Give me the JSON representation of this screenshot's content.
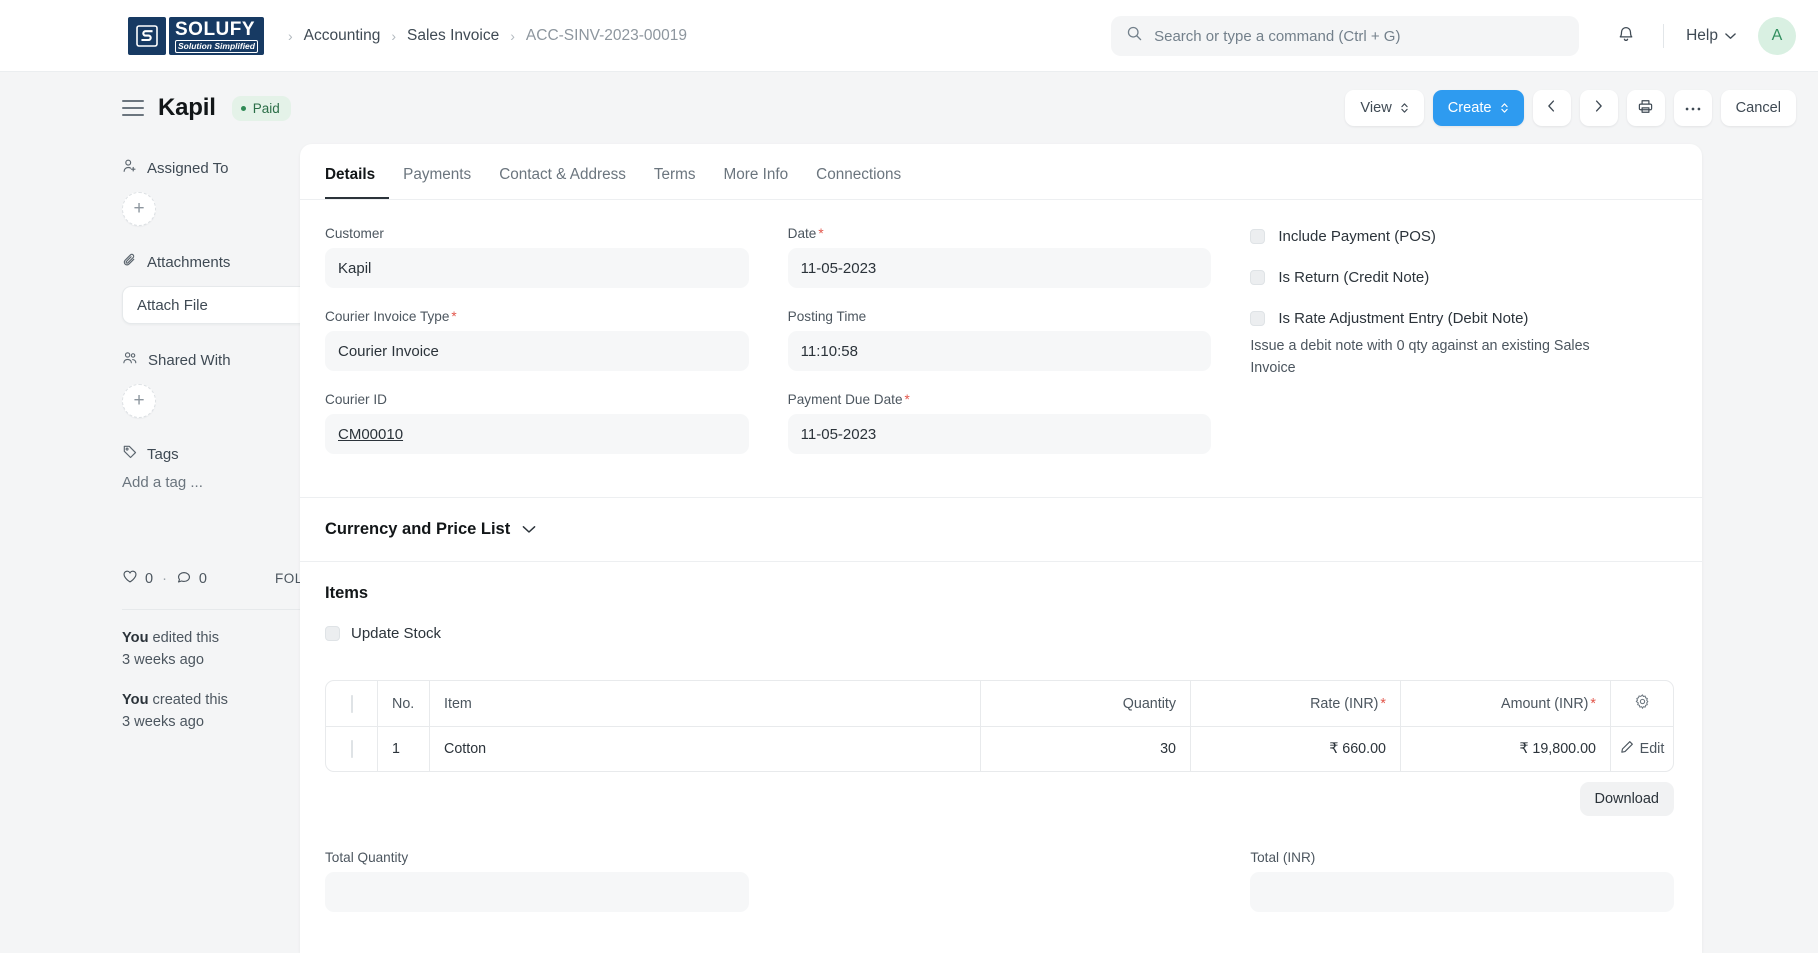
{
  "navbar": {
    "logo": {
      "word": "SOLUFY",
      "tagline": "Solution Simplified",
      "mark_letter": "S"
    },
    "breadcrumb": [
      {
        "label": "Accounting",
        "muted": false
      },
      {
        "label": "Sales Invoice",
        "muted": false
      },
      {
        "label": "ACC-SINV-2023-00019",
        "muted": true
      }
    ],
    "search": {
      "placeholder": "Search or type a command (Ctrl + G)",
      "value": ""
    },
    "help_label": "Help",
    "avatar_initial": "A",
    "icons": {
      "search": "search-icon",
      "bell": "notification-bell-icon",
      "chevron": "chevron-down-icon"
    }
  },
  "page_head": {
    "title": "Kapil",
    "status_badge": "Paid",
    "actions": {
      "view": "View",
      "create": "Create",
      "prev": "‹",
      "next": "›",
      "print": "print-icon",
      "more": "···",
      "cancel": "Cancel"
    }
  },
  "sidebar": {
    "assigned_to": {
      "label": "Assigned To",
      "add": "+"
    },
    "attachments": {
      "label": "Attachments",
      "button": "Attach File",
      "add": "+"
    },
    "shared_with": {
      "label": "Shared With",
      "add": "+"
    },
    "tags": {
      "label": "Tags",
      "placeholder": "Add a tag ..."
    },
    "stats": {
      "likes": "0",
      "separator": "·",
      "comments": "0",
      "follow": "FOLLOW"
    },
    "activity": [
      {
        "who": "You",
        "what": " edited this",
        "when": "3 weeks ago"
      },
      {
        "who": "You",
        "what": " created this",
        "when": "3 weeks ago"
      }
    ]
  },
  "main": {
    "tabs": [
      {
        "label": "Details",
        "active": true
      },
      {
        "label": "Payments",
        "active": false
      },
      {
        "label": "Contact & Address",
        "active": false
      },
      {
        "label": "Terms",
        "active": false
      },
      {
        "label": "More Info",
        "active": false
      },
      {
        "label": "Connections",
        "active": false
      }
    ],
    "fields": {
      "customer": {
        "label": "Customer",
        "value": "Kapil",
        "required": false
      },
      "courier_invoice_type": {
        "label": "Courier Invoice Type",
        "value": "Courier Invoice",
        "required": true
      },
      "courier_id": {
        "label": "Courier ID",
        "value": "CM00010",
        "required": false
      },
      "date": {
        "label": "Date",
        "value": "11-05-2023",
        "required": true
      },
      "posting_time": {
        "label": "Posting Time",
        "value": "11:10:58",
        "required": false
      },
      "payment_due_date": {
        "label": "Payment Due Date",
        "value": "11-05-2023",
        "required": true
      }
    },
    "checkboxes": [
      {
        "label": "Include Payment (POS)",
        "checked": false
      },
      {
        "label": "Is Return (Credit Note)",
        "checked": false
      },
      {
        "label": "Is Rate Adjustment Entry (Debit Note)",
        "checked": false
      }
    ],
    "debit_note_hint": "Issue a debit note with 0 qty against an existing Sales Invoice",
    "currency_section": {
      "title": "Currency and Price List",
      "collapsed": true
    },
    "items_section": {
      "title": "Items",
      "update_stock": {
        "label": "Update Stock",
        "checked": false
      },
      "table": {
        "columns": [
          "No.",
          "Item",
          "Quantity",
          "Rate (INR)",
          "Amount (INR)"
        ],
        "required_columns": [
          "Rate (INR)",
          "Amount (INR)"
        ],
        "settings_icon": "gear-icon",
        "rows": [
          {
            "no": "1",
            "item": "Cotton",
            "quantity": "30",
            "rate": "₹ 660.00",
            "amount": "₹ 19,800.00",
            "edit": "Edit"
          }
        ]
      },
      "download_button": "Download"
    },
    "totals": {
      "total_quantity_label": "Total Quantity",
      "total_inr_label": "Total (INR)"
    }
  },
  "colors": {
    "primary": "#2e9bf0",
    "brand_navy": "#173a63",
    "status_green_bg": "#e4f2e8",
    "status_green_text": "#2b6e47",
    "required_red": "#e2564b",
    "page_bg": "#f4f5f6"
  }
}
